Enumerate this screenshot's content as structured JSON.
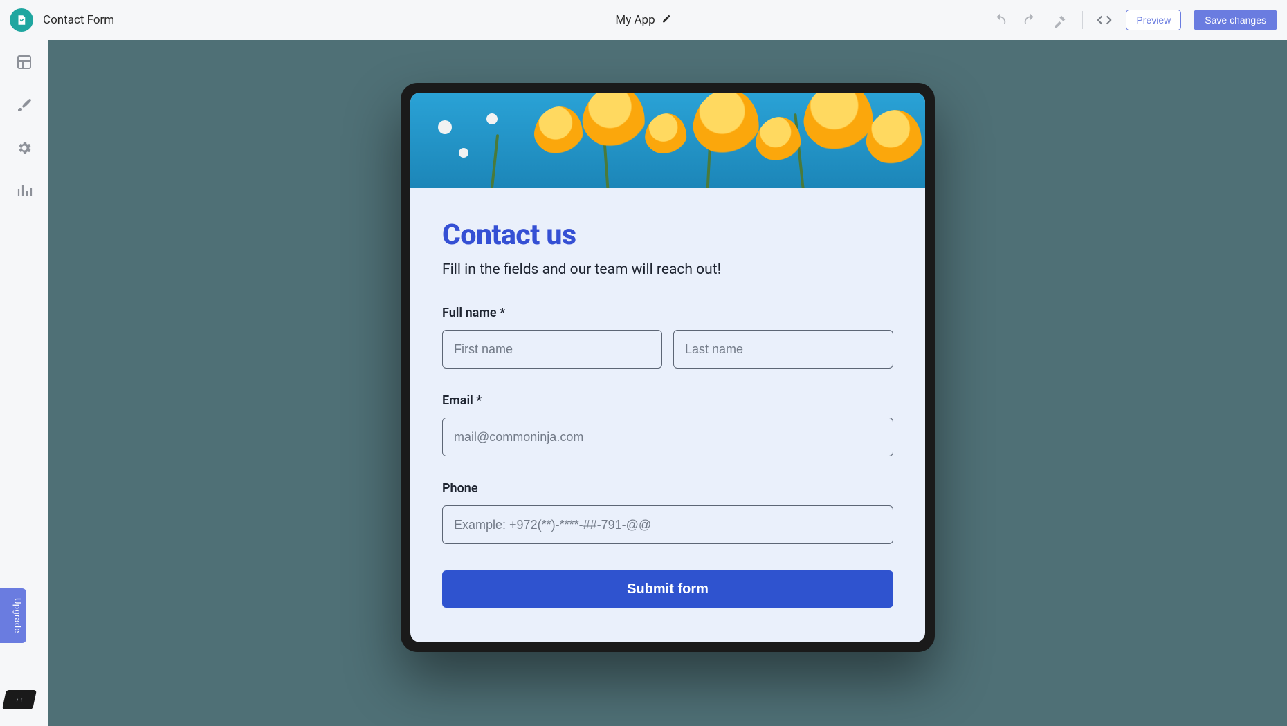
{
  "topbar": {
    "page_title": "Contact Form",
    "app_name": "My App",
    "preview_label": "Preview",
    "save_label": "Save changes"
  },
  "sidebar": {
    "upgrade_label": "Upgrade"
  },
  "form": {
    "title": "Contact us",
    "subtitle": "Fill in the fields and our team will reach out!",
    "full_name_label": "Full name *",
    "first_name_placeholder": "First name",
    "last_name_placeholder": "Last name",
    "email_label": "Email *",
    "email_placeholder": "mail@commoninja.com",
    "phone_label": "Phone",
    "phone_placeholder": "Example: +972(**)-****-##-791-@@",
    "submit_label": "Submit form"
  },
  "colors": {
    "accent_primary": "#6a7ce0",
    "form_title": "#3550d4",
    "submit_bg": "#2f53cf",
    "canvas_bg": "#4f7076",
    "card_bg": "#eaf0fb"
  }
}
